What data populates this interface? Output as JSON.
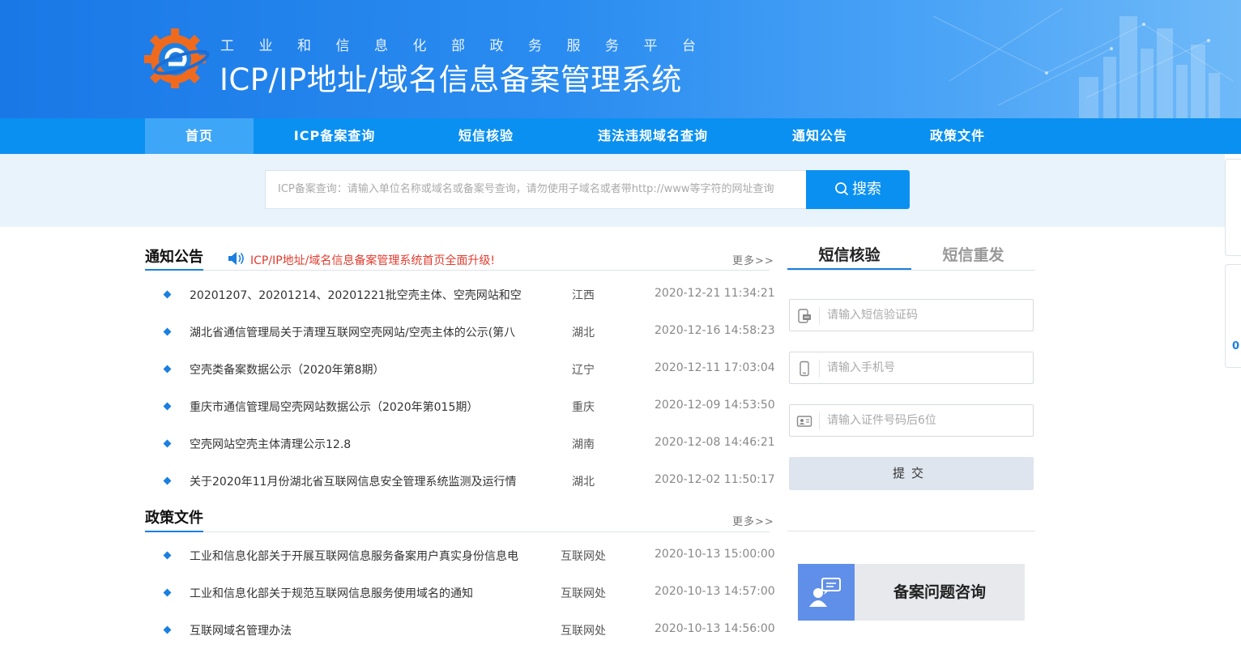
{
  "header": {
    "subtitle": "工业和信息化部政务服务平台",
    "title": "ICP/IP地址/域名信息备案管理系统"
  },
  "nav": [
    {
      "label": "首页",
      "active": true
    },
    {
      "label": "ICP备案查询",
      "active": false
    },
    {
      "label": "短信核验",
      "active": false
    },
    {
      "label": "违法违规域名查询",
      "active": false
    },
    {
      "label": "通知公告",
      "active": false
    },
    {
      "label": "政策文件",
      "active": false
    }
  ],
  "search": {
    "placeholder": "ICP备案查询：请输入单位名称或域名或备案号查询，请勿使用子域名或者带http://www等字符的网址查询",
    "button_label": "搜索"
  },
  "notices": {
    "title": "通知公告",
    "marquee": "ICP/IP地址/域名信息备案管理系统首页全面升级!",
    "more": "更多>>",
    "items": [
      {
        "text": "20201207、20201214、20201221批空壳主体、空壳网站和空壳",
        "region": "江西",
        "time": "2020-12-21 11:34:21"
      },
      {
        "text": "湖北省通信管理局关于清理互联网空壳网站/空壳主体的公示(第八",
        "region": "湖北",
        "time": "2020-12-16 14:58:23"
      },
      {
        "text": "空壳类备案数据公示（2020年第8期）",
        "region": "辽宁",
        "time": "2020-12-11 17:03:04"
      },
      {
        "text": "重庆市通信管理局空壳网站数据公示（2020年第015期）",
        "region": "重庆",
        "time": "2020-12-09 14:53:50"
      },
      {
        "text": "空壳网站空壳主体清理公示12.8",
        "region": "湖南",
        "time": "2020-12-08 14:46:21"
      },
      {
        "text": "关于2020年11月份湖北省互联网信息安全管理系统监测及运行情",
        "region": "湖北",
        "time": "2020-12-02 11:50:17"
      }
    ]
  },
  "policies": {
    "title": "政策文件",
    "more": "更多>>",
    "items": [
      {
        "text": "工业和信息化部关于开展互联网信息服务备案用户真实身份信息电",
        "region": "互联网处",
        "time": "2020-10-13 15:00:00"
      },
      {
        "text": "工业和信息化部关于规范互联网信息服务使用域名的通知",
        "region": "互联网处",
        "time": "2020-10-13 14:57:00"
      },
      {
        "text": "互联网域名管理办法",
        "region": "互联网处",
        "time": "2020-10-13 14:56:00"
      }
    ]
  },
  "sms": {
    "tab_verify": "短信核验",
    "tab_resend": "短信重发",
    "code_placeholder": "请输入短信验证码",
    "phone_placeholder": "请输入手机号",
    "id_placeholder": "请输入证件号码后6位",
    "submit_label": "提交"
  },
  "consult": {
    "label": "备案问题咨询"
  },
  "edge": {
    "counter": "0"
  },
  "colors": {
    "brand_blue": "#0a90f0",
    "accent_blue": "#1a7fe0",
    "alert_red": "#e23b2e"
  }
}
